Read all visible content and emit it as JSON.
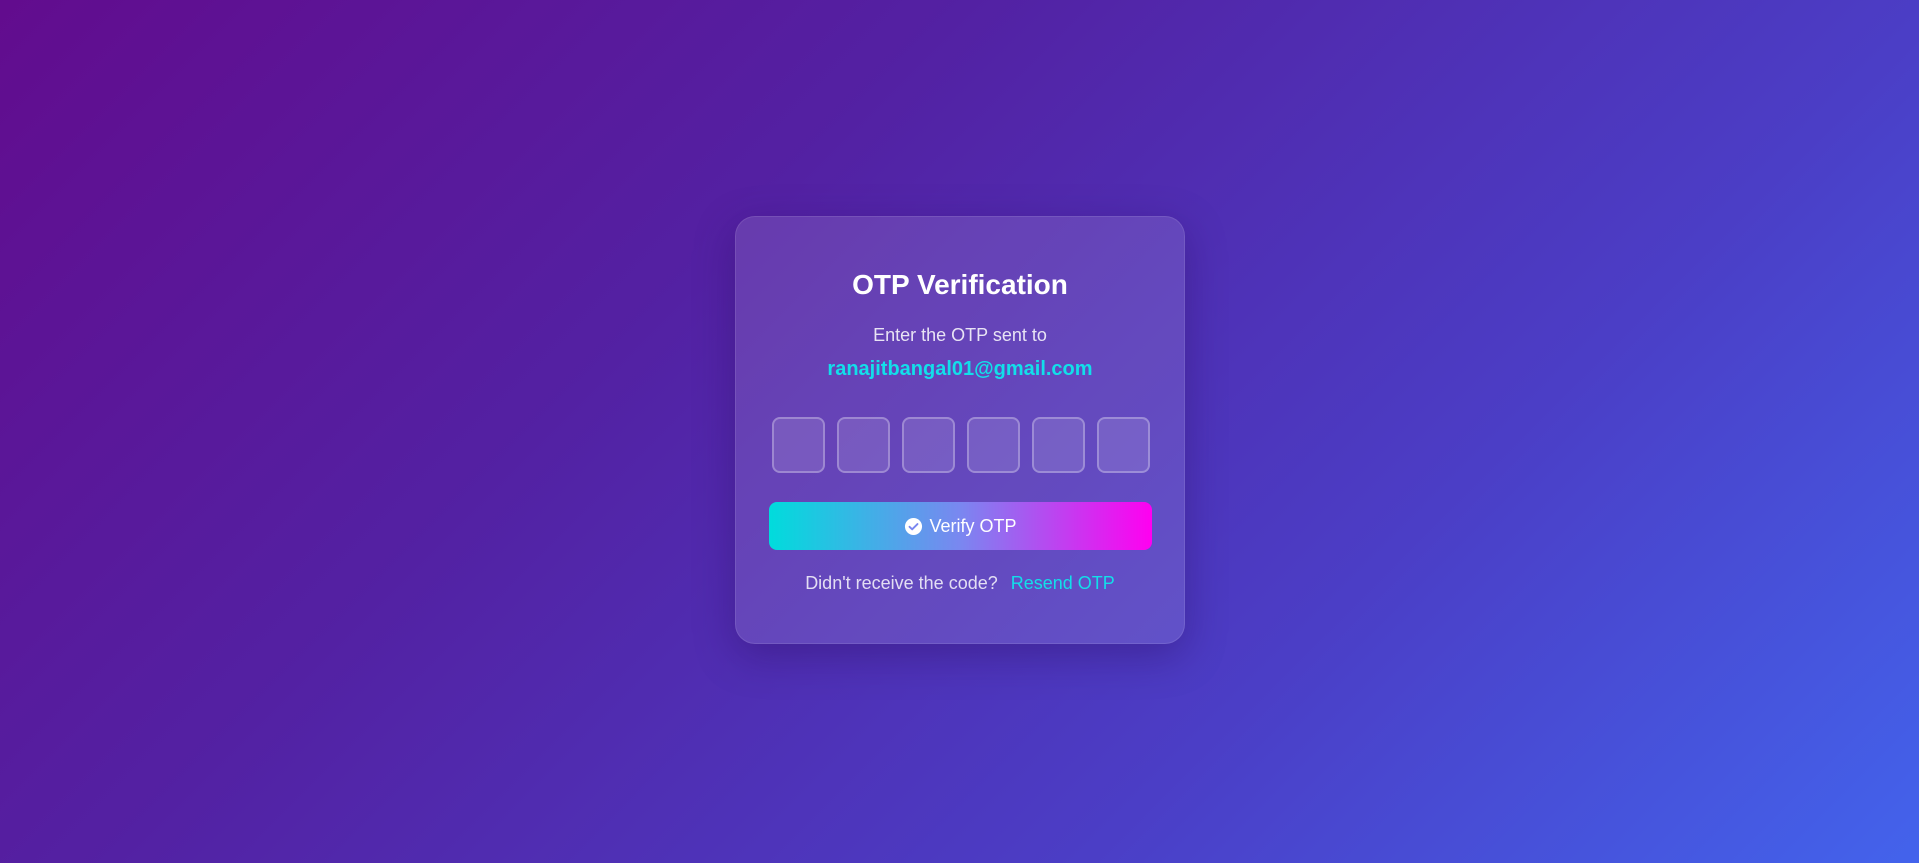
{
  "card": {
    "title": "OTP Verification",
    "subtitle": "Enter the OTP sent to",
    "email": "ranajitbangal01@gmail.com"
  },
  "otp": {
    "digits": [
      "",
      "",
      "",
      "",
      "",
      ""
    ]
  },
  "verify_button": {
    "label": "Verify OTP",
    "icon": "check-circle-icon"
  },
  "resend": {
    "prompt": "Didn't receive the code?",
    "link_label": "Resend OTP"
  },
  "colors": {
    "background_start": "#620c8e",
    "background_end": "#4363ec",
    "accent": "#12dfea",
    "button_gradient_start": "#00dcdc",
    "button_gradient_end": "#ff00f0"
  }
}
